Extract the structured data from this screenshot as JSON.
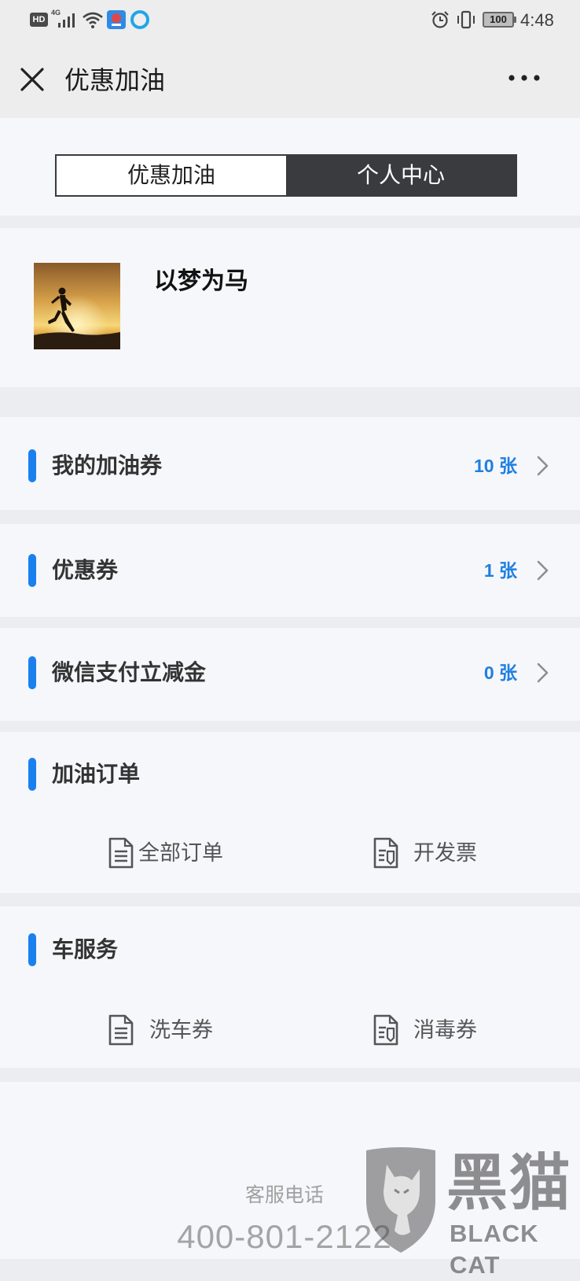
{
  "status_bar": {
    "hd_badge": "HD",
    "network": "4G",
    "battery": "100",
    "time": "4:48",
    "icons": [
      "signal-icon",
      "wifi-icon",
      "app-notification-icon",
      "browser-notification-icon",
      "alarm-icon",
      "vibrate-icon",
      "battery-icon"
    ]
  },
  "header": {
    "title": "优惠加油",
    "left_icon": "close-icon",
    "right_icon": "more-icon"
  },
  "segmented": {
    "tabs": [
      {
        "label": "优惠加油",
        "active": false
      },
      {
        "label": "个人中心",
        "active": true
      }
    ]
  },
  "profile": {
    "name": "以梦为马",
    "avatar": "runner-at-sunset-photo"
  },
  "wallet_rows": [
    {
      "label": "我的加油券",
      "count": "10 张"
    },
    {
      "label": "优惠券",
      "count": "1 张"
    },
    {
      "label": "微信支付立减金",
      "count": "0 张"
    }
  ],
  "sections": [
    {
      "title": "加油订单",
      "items": [
        {
          "label": "全部订单",
          "icon": "document-icon"
        },
        {
          "label": "开发票",
          "icon": "invoice-icon"
        }
      ]
    },
    {
      "title": "车服务",
      "items": [
        {
          "label": "洗车券",
          "icon": "document-icon"
        },
        {
          "label": "消毒券",
          "icon": "invoice-icon"
        }
      ]
    }
  ],
  "footer": {
    "label": "客服电话",
    "phone": "400-801-2122"
  },
  "watermark": {
    "cn": "黑猫",
    "en": "BLACK CAT"
  },
  "colors": {
    "accent": "#1a80f0",
    "count_text": "#1f7fe0",
    "active_tab_bg": "#3a3b3f",
    "card_bg": "#f6f7fb",
    "page_bg": "#ecedf1"
  }
}
